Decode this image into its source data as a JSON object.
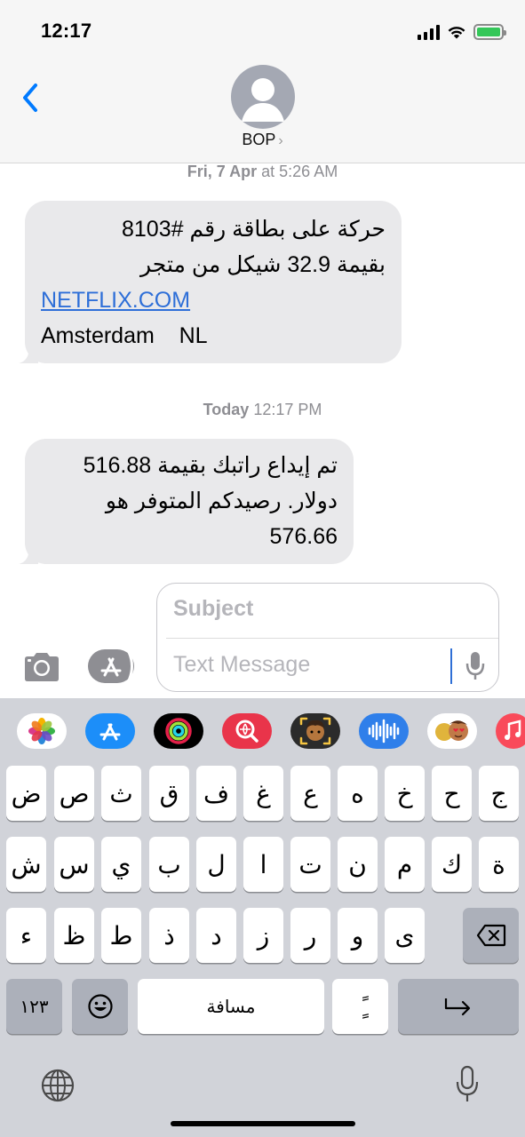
{
  "status_bar": {
    "time": "12:17"
  },
  "header": {
    "contact_name": "BOP",
    "chevron": "›"
  },
  "messages": [
    {
      "timestamp_day": "Fri, 7 Apr",
      "timestamp_time": " at 5:26 AM",
      "lines": [
        "حركة على بطاقة رقم #8103",
        "بقيمة 32.9 شيكل من متجر"
      ],
      "link": "NETFLIX.COM",
      "last_line": "Amsterdam    NL"
    },
    {
      "timestamp_day": "Today",
      "timestamp_time": " 12:17 PM",
      "lines": [
        "تم إيداع راتبك بقيمة 516.88",
        "دولار. رصيدكم المتوفر هو",
        "576.66"
      ]
    }
  ],
  "compose": {
    "subject_placeholder": "Subject",
    "message_placeholder": "Text Message"
  },
  "app_strip": [
    "photos-app-icon",
    "app-store-app-icon",
    "fitness-activity-app-icon",
    "search-images-app-icon",
    "memoji-app-icon",
    "audio-message-app-icon",
    "memoji-stickers-app-icon",
    "music-app-icon"
  ],
  "keyboard": {
    "row1": [
      "ض",
      "ص",
      "ث",
      "ق",
      "ف",
      "غ",
      "ع",
      "ه",
      "خ",
      "ح",
      "ج"
    ],
    "row2": [
      "ش",
      "س",
      "ي",
      "ب",
      "ل",
      "ا",
      "ت",
      "ن",
      "م",
      "ك",
      "ة"
    ],
    "row3": [
      "ء",
      "ظ",
      "ط",
      "ذ",
      "د",
      "ز",
      "ر",
      "و",
      "ى"
    ],
    "numbers_key": "١٢٣",
    "space_key": "مسافة",
    "diacritic_key": "ًٍ"
  },
  "colors": {
    "bubble_gray": "#e9e9eb",
    "link_blue": "#2e6fd8",
    "ios_blue": "#007aff",
    "keyboard_bg": "#d1d3d9",
    "battery_green": "#34c759"
  }
}
